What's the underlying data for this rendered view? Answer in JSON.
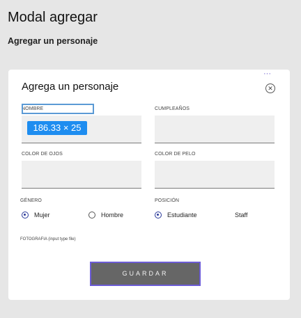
{
  "page": {
    "title": "Modal agregar",
    "subtitle": "Agregar un personaje"
  },
  "modal": {
    "title": "Agrega un personaje",
    "more_icon": "ellipsis-icon",
    "close_icon": "close-icon",
    "close_glyph": "✕",
    "more_glyph": "···"
  },
  "form": {
    "nombre_label": "NOMBRE",
    "nombre_value": "",
    "size_badge": "186.33 × 25",
    "cumpleanos_label": "CUMPLEAÑOS",
    "cumpleanos_value": "",
    "color_ojos_label": "COLOR DE OJOS",
    "color_ojos_value": "",
    "color_pelo_label": "COLOR DE PELO",
    "color_pelo_value": "",
    "genero_label": "GÉNERO",
    "genero_options": [
      {
        "label": "Mujer",
        "selected": true
      },
      {
        "label": "Hombre",
        "selected": false
      }
    ],
    "posicion_label": "POSICIÓN",
    "posicion_options": [
      {
        "label": "Estudiante",
        "selected": true
      },
      {
        "label": "Staff",
        "selected": false
      }
    ],
    "fotografia_label": "FOTOGRAFIA (input type file)",
    "save_label": "GUARDAR"
  },
  "colors": {
    "background": "#e6e6e6",
    "modal_bg": "#ffffff",
    "input_bg": "#efefef",
    "button_bg": "#666666",
    "button_border": "#6c5cd6",
    "focus_badge": "#1e8df0",
    "radio_accent": "#2a3a9a"
  }
}
